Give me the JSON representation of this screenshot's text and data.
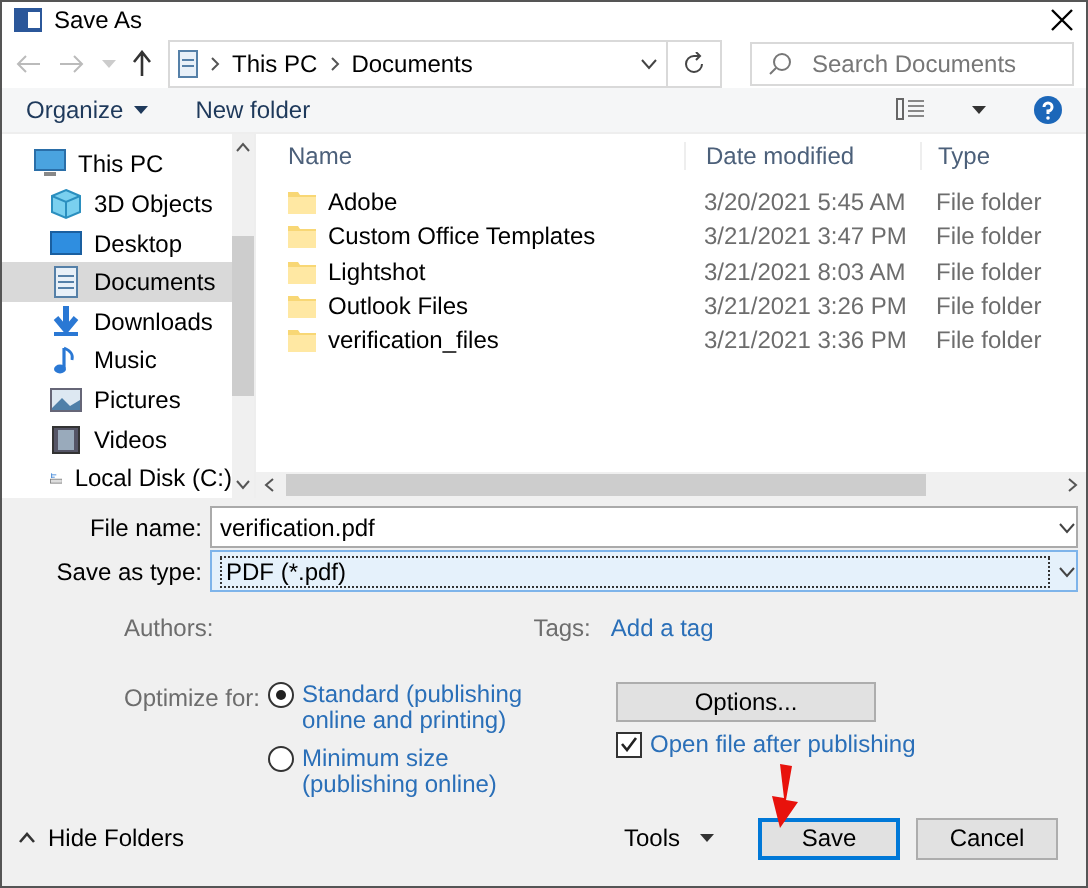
{
  "window": {
    "title": "Save As"
  },
  "nav": {
    "path": [
      "This PC",
      "Documents"
    ],
    "search": {
      "placeholder": "Search Documents"
    }
  },
  "toolbar": {
    "organize": "Organize",
    "new_folder": "New folder"
  },
  "sidebar": {
    "items": [
      {
        "label": "This PC",
        "kind": "computer",
        "selected": false,
        "children": [
          {
            "label": "3D Objects",
            "kind": "cube",
            "selected": false
          },
          {
            "label": "Desktop",
            "kind": "desktop",
            "selected": false
          },
          {
            "label": "Documents",
            "kind": "document",
            "selected": true
          },
          {
            "label": "Downloads",
            "kind": "download",
            "selected": false
          },
          {
            "label": "Music",
            "kind": "music",
            "selected": false
          },
          {
            "label": "Pictures",
            "kind": "picture",
            "selected": false
          },
          {
            "label": "Videos",
            "kind": "video",
            "selected": false
          },
          {
            "label": "Local Disk (C:)",
            "kind": "disk",
            "selected": false
          }
        ]
      }
    ]
  },
  "files": {
    "columns": [
      "Name",
      "Date modified",
      "Type"
    ],
    "rows": [
      {
        "name": "Adobe",
        "date": "3/20/2021 5:45 AM",
        "type": "File folder"
      },
      {
        "name": "Custom Office Templates",
        "date": "3/21/2021 3:47 PM",
        "type": "File folder"
      },
      {
        "name": "Lightshot",
        "date": "3/21/2021 8:03 AM",
        "type": "File folder"
      },
      {
        "name": "Outlook Files",
        "date": "3/21/2021 3:26 PM",
        "type": "File folder"
      },
      {
        "name": "verification_files",
        "date": "3/21/2021 3:36 PM",
        "type": "File folder"
      }
    ]
  },
  "form": {
    "file_name": {
      "label": "File name:",
      "value": "verification.pdf"
    },
    "save_type": {
      "label": "Save as type:",
      "value": "PDF (*.pdf)"
    },
    "authors": {
      "label": "Authors:"
    },
    "tags": {
      "label": "Tags:",
      "value": "Add a tag"
    },
    "optimize": {
      "label": "Optimize for:",
      "options": [
        {
          "label": "Standard (publishing online and printing)",
          "selected": true
        },
        {
          "label": "Minimum size (publishing online)",
          "selected": false
        }
      ]
    },
    "options_button": "Options...",
    "open_after": {
      "label": "Open file after publishing",
      "checked": true
    }
  },
  "footer": {
    "hide_folders": "Hide Folders",
    "tools": "Tools",
    "buttons": [
      {
        "label": "Save",
        "default": true
      },
      {
        "label": "Cancel",
        "default": false
      }
    ]
  }
}
